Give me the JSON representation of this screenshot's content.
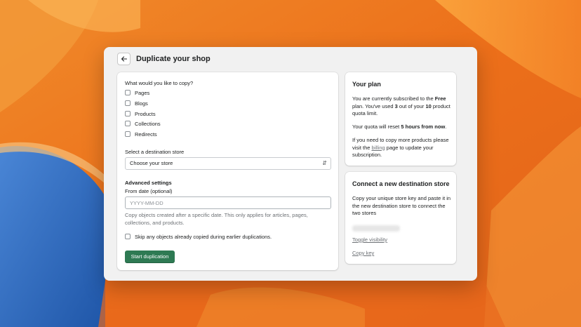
{
  "header": {
    "title": "Duplicate your shop",
    "back_icon": "arrow-left-icon"
  },
  "copy_section": {
    "question": "What would you like to copy?",
    "options": [
      {
        "label": "Pages",
        "checked": false
      },
      {
        "label": "Blogs",
        "checked": false
      },
      {
        "label": "Products",
        "checked": false
      },
      {
        "label": "Collections",
        "checked": false
      },
      {
        "label": "Redirects",
        "checked": false
      }
    ]
  },
  "destination": {
    "label": "Select a destination store",
    "selected": "Choose your store"
  },
  "advanced": {
    "heading": "Advanced settings",
    "from_date_label": "From date (optional)",
    "from_date_placeholder": "YYYY-MM-DD",
    "from_date_value": "",
    "help_text": "Copy objects created after a specific date. This only applies for articles, pages, collections, and products.",
    "skip_label": "Skip any objects already copied during earlier duplications.",
    "skip_checked": false
  },
  "start_button": "Start duplication",
  "plan": {
    "title": "Your plan",
    "line1_a": "You are currently subscribed to the ",
    "plan_name": "Free",
    "line1_b": " plan. You've used ",
    "used": "3",
    "line1_c": " out of your ",
    "limit": "10",
    "line1_d": " product quota limit.",
    "reset_a": "Your quota will reset ",
    "reset_time": "5 hours from now",
    "reset_b": ".",
    "more_a": "If you need to copy more products please visit the ",
    "billing_link": "billing",
    "more_b": " page to update your subscription."
  },
  "connect": {
    "title": "Connect a new destination store",
    "description": "Copy your unique store key and paste it in the new destination store to connect the two stores",
    "toggle_link": "Toggle visibility",
    "copy_link": "Copy key"
  },
  "colors": {
    "primary_button": "#2e7a53",
    "wallpaper_orange": "#ee7a1f",
    "wallpaper_blue": "#2f6fc2"
  }
}
